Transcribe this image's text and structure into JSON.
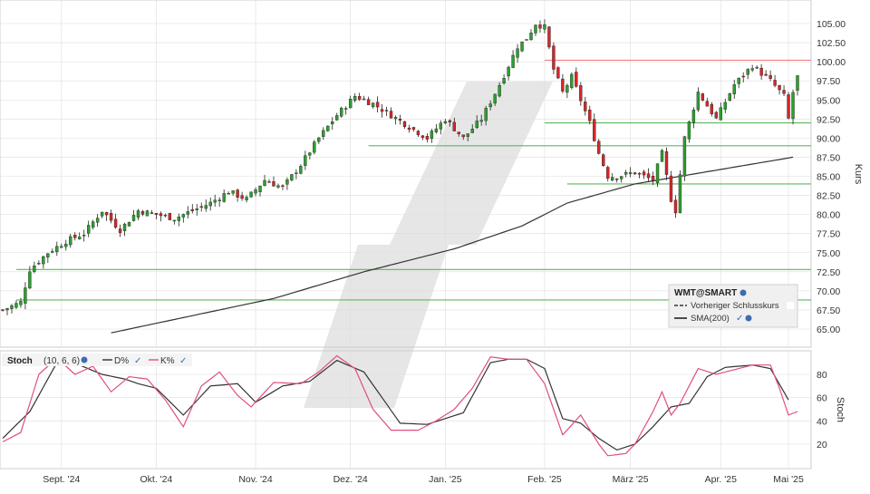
{
  "colors": {
    "up": "#2ca02c",
    "down": "#d62728",
    "resistance": "#f08080",
    "support": "#5cb85c",
    "sma": "#333333",
    "k_line": "#e0507a",
    "d_line": "#333333",
    "grid": "#dddddd",
    "watermark": "#e6e6e6"
  },
  "chart_data": [
    {
      "type": "candlestick",
      "ylabel": "Kurs",
      "ylim": [
        62.5,
        107.5
      ],
      "yticks": [
        "105.00",
        "102.50",
        "100.00",
        "97.50",
        "95.00",
        "92.50",
        "90.00",
        "87.50",
        "85.00",
        "82.50",
        "80.00",
        "77.50",
        "75.00",
        "72.50",
        "70.00",
        "67.50",
        "65.00"
      ],
      "x_labels": [
        "Sept. '24",
        "Okt. '24",
        "Nov. '24",
        "Dez. '24",
        "Jan. '25",
        "Feb. '25",
        "März '25",
        "Apr. '25",
        "Mai '25"
      ],
      "price_keypoints": [
        [
          0,
          67.5
        ],
        [
          4,
          68.5
        ],
        [
          6,
          72.8
        ],
        [
          10,
          75.0
        ],
        [
          14,
          76.5
        ],
        [
          18,
          77.5
        ],
        [
          22,
          80.5
        ],
        [
          26,
          78.0
        ],
        [
          30,
          80.5
        ],
        [
          34,
          80.0
        ],
        [
          38,
          79.5
        ],
        [
          42,
          80.5
        ],
        [
          46,
          81.5
        ],
        [
          50,
          83.0
        ],
        [
          54,
          82.0
        ],
        [
          58,
          84.5
        ],
        [
          62,
          83.5
        ],
        [
          66,
          86.5
        ],
        [
          70,
          90.0
        ],
        [
          74,
          93.0
        ],
        [
          78,
          95.5
        ],
        [
          82,
          94.5
        ],
        [
          86,
          93.0
        ],
        [
          90,
          91.5
        ],
        [
          94,
          90.0
        ],
        [
          98,
          92.5
        ],
        [
          102,
          90.0
        ],
        [
          106,
          92.5
        ],
        [
          110,
          97.0
        ],
        [
          114,
          102.0
        ],
        [
          116,
          103.0
        ],
        [
          118,
          105.0
        ],
        [
          120,
          104.5
        ],
        [
          122,
          99.0
        ],
        [
          124,
          96.0
        ],
        [
          126,
          98.0
        ],
        [
          128,
          95.0
        ],
        [
          130,
          92.0
        ],
        [
          132,
          88.0
        ],
        [
          134,
          85.0
        ],
        [
          136,
          85.0
        ],
        [
          140,
          85.5
        ],
        [
          144,
          84.5
        ],
        [
          146,
          88.0
        ],
        [
          148,
          82.0
        ],
        [
          149,
          80.5
        ],
        [
          151,
          90.0
        ],
        [
          154,
          96.0
        ],
        [
          158,
          92.5
        ],
        [
          162,
          97.0
        ],
        [
          166,
          99.5
        ],
        [
          170,
          97.5
        ],
        [
          173,
          95.5
        ],
        [
          174,
          92.5
        ],
        [
          175,
          96.0
        ],
        [
          176,
          98.0
        ]
      ],
      "hlines": [
        {
          "value": 100.2,
          "style": "resistance",
          "from_bar": 120
        },
        {
          "value": 92.0,
          "style": "support",
          "from_bar": 120
        },
        {
          "value": 89.0,
          "style": "support",
          "from_bar": 81
        },
        {
          "value": 84.0,
          "style": "support",
          "from_bar": 125
        },
        {
          "value": 72.8,
          "style": "support",
          "from_bar": 3
        },
        {
          "value": 68.8,
          "style": "support",
          "from_bar": 3
        }
      ],
      "sma_points": [
        [
          24,
          64.5
        ],
        [
          60,
          69.0
        ],
        [
          80,
          72.5
        ],
        [
          100,
          75.5
        ],
        [
          115,
          78.5
        ],
        [
          125,
          81.5
        ],
        [
          140,
          84.0
        ],
        [
          150,
          85.0
        ],
        [
          175,
          87.5
        ]
      ],
      "legend": {
        "symbol": "WMT@SMART",
        "items": [
          "Vorheriger Schlusskurs",
          "SMA(200)"
        ]
      }
    },
    {
      "type": "line",
      "title": "Stoch",
      "params": "(10, 6, 6)",
      "ylabel": "Stoch",
      "ylim": [
        0,
        100
      ],
      "yticks": [
        "80",
        "60",
        "40",
        "20"
      ],
      "series": [
        {
          "name": "D%",
          "points": [
            [
              0,
              25
            ],
            [
              6,
              48
            ],
            [
              12,
              90
            ],
            [
              17,
              88
            ],
            [
              22,
              80
            ],
            [
              27,
              76
            ],
            [
              30,
              72
            ],
            [
              34,
              68
            ],
            [
              40,
              45
            ],
            [
              46,
              70
            ],
            [
              52,
              72
            ],
            [
              56,
              56
            ],
            [
              62,
              70
            ],
            [
              68,
              74
            ],
            [
              74,
              92
            ],
            [
              80,
              82
            ],
            [
              84,
              60
            ],
            [
              88,
              38
            ],
            [
              94,
              37
            ],
            [
              98,
              42
            ],
            [
              102,
              47
            ],
            [
              108,
              90
            ],
            [
              112,
              93
            ],
            [
              116,
              93
            ],
            [
              120,
              85
            ],
            [
              124,
              42
            ],
            [
              128,
              38
            ],
            [
              132,
              25
            ],
            [
              136,
              15
            ],
            [
              140,
              20
            ],
            [
              144,
              35
            ],
            [
              148,
              52
            ],
            [
              152,
              55
            ],
            [
              156,
              78
            ],
            [
              160,
              86
            ],
            [
              166,
              88
            ],
            [
              170,
              85
            ],
            [
              174,
              58
            ]
          ]
        },
        {
          "name": "K%",
          "points": [
            [
              0,
              22
            ],
            [
              4,
              30
            ],
            [
              8,
              80
            ],
            [
              12,
              94
            ],
            [
              16,
              80
            ],
            [
              20,
              87
            ],
            [
              24,
              65
            ],
            [
              28,
              78
            ],
            [
              32,
              76
            ],
            [
              36,
              58
            ],
            [
              40,
              35
            ],
            [
              44,
              70
            ],
            [
              48,
              82
            ],
            [
              52,
              62
            ],
            [
              55,
              52
            ],
            [
              60,
              73
            ],
            [
              66,
              72
            ],
            [
              70,
              82
            ],
            [
              74,
              96
            ],
            [
              78,
              85
            ],
            [
              82,
              50
            ],
            [
              86,
              32
            ],
            [
              92,
              32
            ],
            [
              96,
              40
            ],
            [
              100,
              50
            ],
            [
              104,
              68
            ],
            [
              108,
              95
            ],
            [
              112,
              93
            ],
            [
              116,
              93
            ],
            [
              120,
              72
            ],
            [
              124,
              28
            ],
            [
              128,
              45
            ],
            [
              132,
              20
            ],
            [
              134,
              10
            ],
            [
              138,
              12
            ],
            [
              140,
              20
            ],
            [
              144,
              48
            ],
            [
              146,
              65
            ],
            [
              148,
              45
            ],
            [
              150,
              55
            ],
            [
              154,
              85
            ],
            [
              158,
              80
            ],
            [
              166,
              88
            ],
            [
              170,
              88
            ],
            [
              172,
              68
            ],
            [
              174,
              45
            ],
            [
              176,
              48
            ]
          ]
        }
      ]
    }
  ]
}
